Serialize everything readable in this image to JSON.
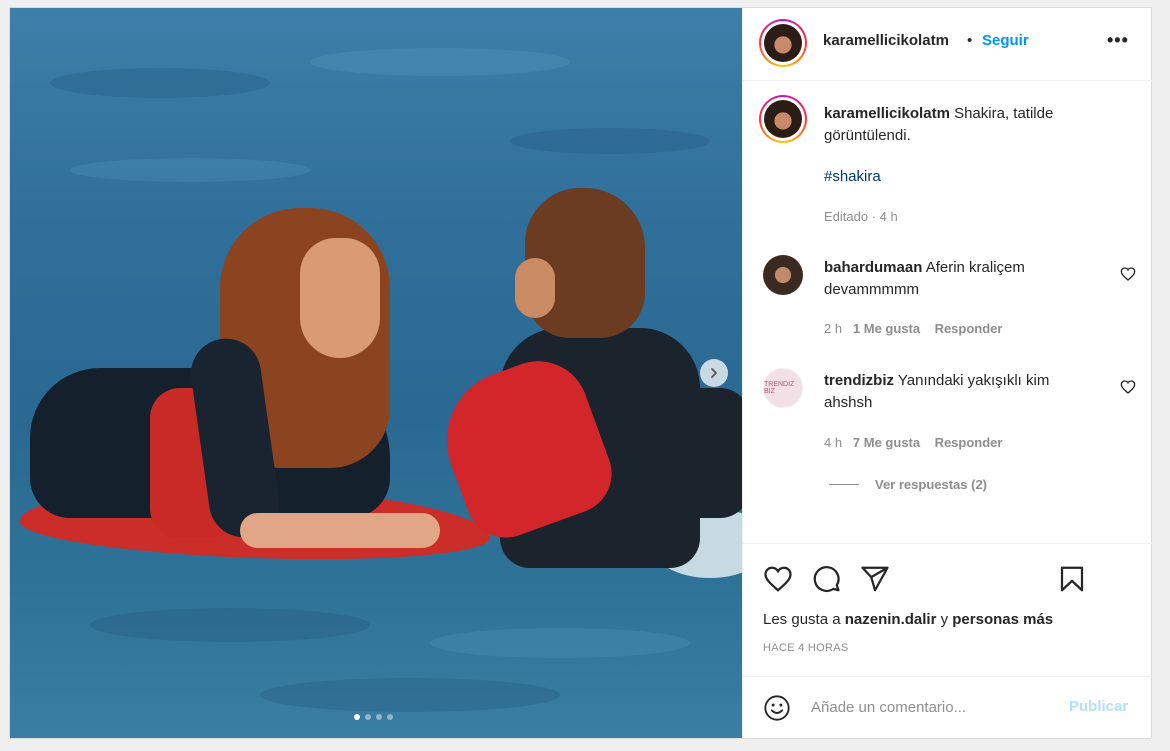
{
  "post": {
    "author": "karamellicikolatm",
    "separator": "•",
    "follow_label": "Seguir",
    "more_label": "•••",
    "caption": {
      "user": "karamellicikolatm",
      "text": "Shakira, tatilde görüntülendi.",
      "hashtag": "#shakira",
      "meta": "Editado · 4 h"
    },
    "carousel": {
      "current": 1,
      "total": 4
    }
  },
  "comments": [
    {
      "user": "bahardumaan",
      "text": "Aferin kraliçem devammmmm",
      "time": "2 h",
      "likes": "1 Me gusta",
      "reply_label": "Responder"
    },
    {
      "user": "trendizbiz",
      "text": "Yanındaki yakışıklı kim ahshsh",
      "time": "4 h",
      "likes": "7 Me gusta",
      "reply_label": "Responder",
      "avatar_text": "TRENDIZ BIZ",
      "view_replies": "Ver respuestas (2)"
    }
  ],
  "likes": {
    "prefix": "Les gusta a",
    "user": "nazenin.dalir",
    "connector": "y",
    "suffix": "personas más"
  },
  "timestamp": "HACE 4 HORAS",
  "comment_box": {
    "placeholder": "Añade un comentario...",
    "publish_label": "Publicar"
  },
  "icons": {
    "like": "heart-icon",
    "comment": "comment-icon",
    "share": "send-icon",
    "save": "bookmark-icon",
    "emoji": "emoji-icon",
    "next": "chevron-right-icon"
  },
  "colors": {
    "accent": "#0095f6",
    "link": "#00376b",
    "muted": "#8e8e8e",
    "publish_disabled": "#b2dffc"
  }
}
